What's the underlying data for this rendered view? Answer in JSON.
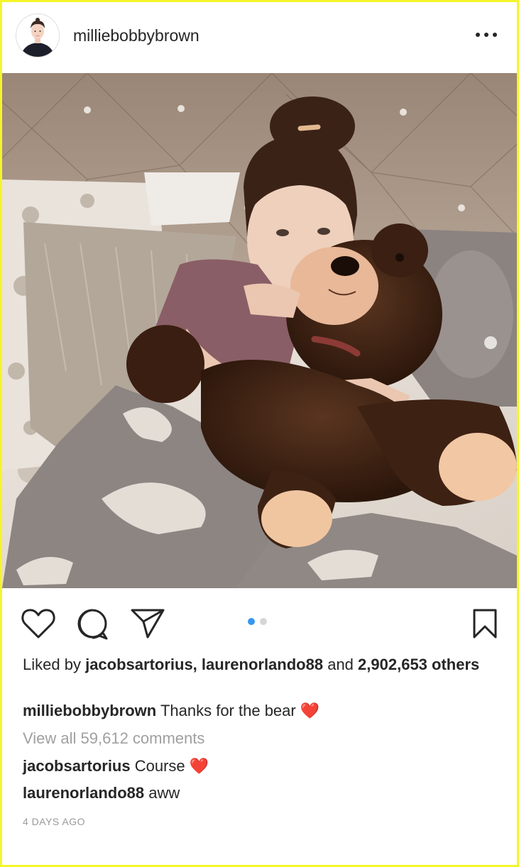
{
  "post": {
    "username": "milliebobbybrown",
    "image_alt": "Girl hugging a large brown teddy bear on a bed with pillows and a grey elephant-pattern blanket"
  },
  "actions": {
    "like_icon": "heart-outline-icon",
    "comment_icon": "comment-bubble-icon",
    "share_icon": "send-paper-plane-icon",
    "save_icon": "bookmark-icon",
    "carousel_count": 2,
    "carousel_active": 0
  },
  "likes": {
    "prefix": "Liked by",
    "user1": "jacobsartorius,",
    "user2": "laurenorlando88",
    "and": "and",
    "count": "2,902,653",
    "suffix": "others"
  },
  "caption": {
    "username": "milliebobbybrown",
    "text": "Thanks for the bear",
    "emoji": "❤️"
  },
  "comments": {
    "view_all": "View all 59,612 comments",
    "items": [
      {
        "username": "jacobsartorius",
        "text": "Course",
        "emoji": "❤️"
      },
      {
        "username": "laurenorlando88",
        "text": "aww"
      }
    ]
  },
  "timestamp": "4 DAYS AGO",
  "colors": {
    "frame_border": "#f5f52a",
    "accent_blue": "#3897f0",
    "heart_red": "#ed1c24",
    "text_primary": "#262626",
    "text_secondary": "#a0a0a0"
  }
}
